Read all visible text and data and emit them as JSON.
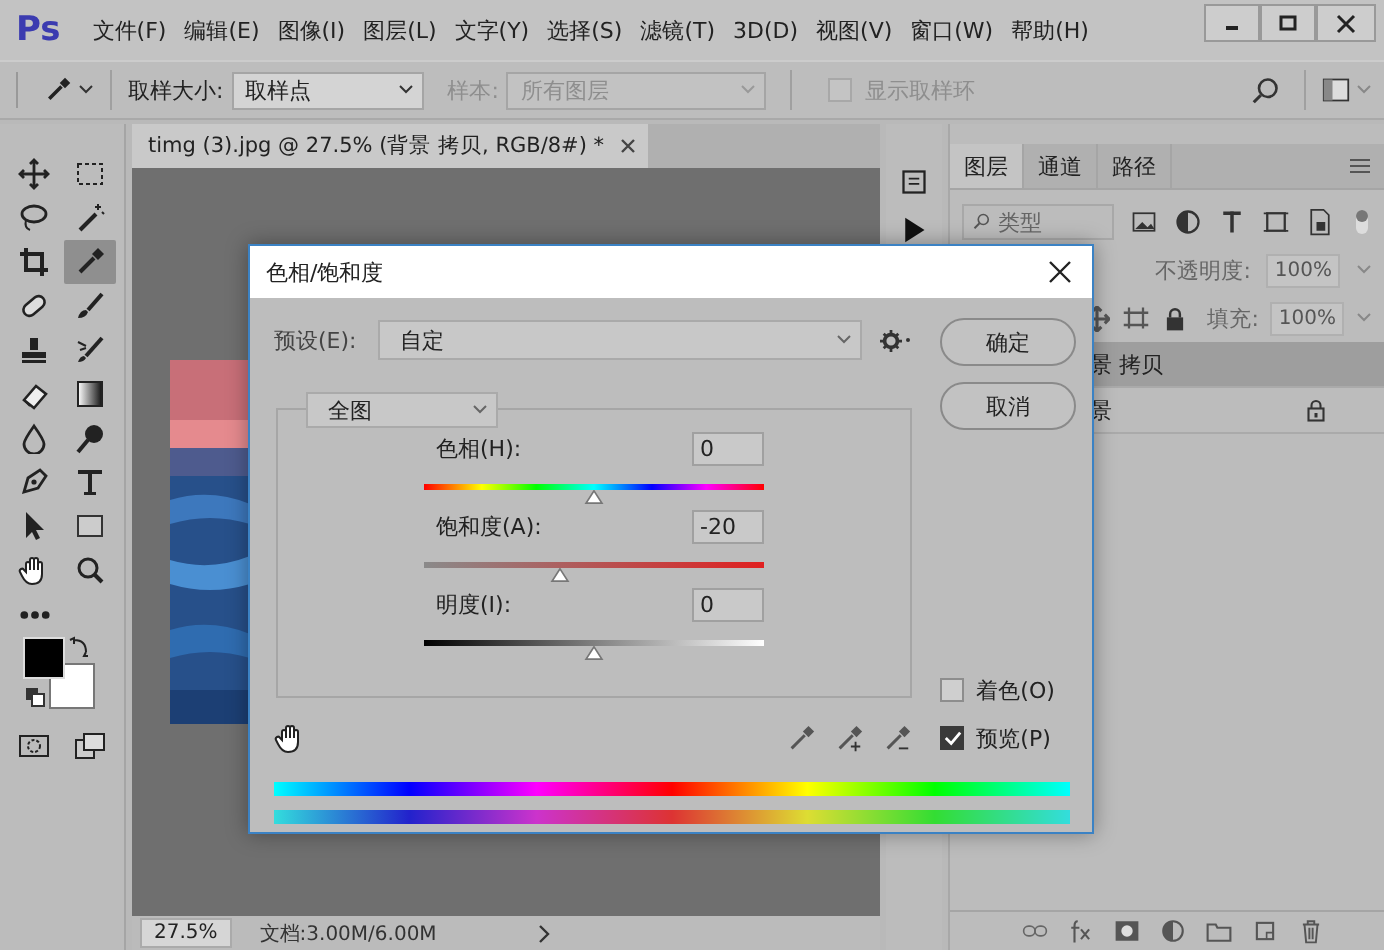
{
  "app": {
    "logo": "Ps"
  },
  "menu": [
    "文件(F)",
    "编辑(E)",
    "图像(I)",
    "图层(L)",
    "文字(Y)",
    "选择(S)",
    "滤镜(T)",
    "3D(D)",
    "视图(V)",
    "窗口(W)",
    "帮助(H)"
  ],
  "options_bar": {
    "sample_size_label": "取样大小:",
    "sample_size": "取样点",
    "sample_label": "样本:",
    "sample": "所有图层",
    "sample_disabled": true,
    "show_ring": {
      "label": "显示取样环",
      "checked": false,
      "disabled": true
    }
  },
  "tools": [
    {
      "kind": "move",
      "selected": false
    },
    {
      "kind": "marquee",
      "selected": false
    },
    {
      "kind": "lasso",
      "selected": false
    },
    {
      "kind": "magic-wand",
      "selected": false
    },
    {
      "kind": "crop",
      "selected": false
    },
    {
      "kind": "eyedropper",
      "selected": true
    },
    {
      "kind": "healing",
      "selected": false
    },
    {
      "kind": "brush",
      "selected": false
    },
    {
      "kind": "stamp",
      "selected": false
    },
    {
      "kind": "history-brush",
      "selected": false
    },
    {
      "kind": "eraser",
      "selected": false
    },
    {
      "kind": "gradient",
      "selected": false
    },
    {
      "kind": "blur",
      "selected": false
    },
    {
      "kind": "dodge",
      "selected": false
    },
    {
      "kind": "pen",
      "selected": false
    },
    {
      "kind": "type",
      "selected": false
    },
    {
      "kind": "path-select",
      "selected": false
    },
    {
      "kind": "rectangle",
      "selected": false
    },
    {
      "kind": "hand",
      "selected": false
    },
    {
      "kind": "zoom",
      "selected": false
    },
    {
      "kind": "more",
      "selected": false
    }
  ],
  "bottom_tools": [
    {
      "kind": "quick-mask"
    },
    {
      "kind": "screen-mode"
    }
  ],
  "document": {
    "tab_title": "timg (3).jpg @ 27.5% (背景 拷贝, RGB/8#) *",
    "zoom": "27.5%",
    "doc_info": "文档:3.00M/6.00M"
  },
  "layers_panel": {
    "tabs": [
      {
        "label": "图层",
        "selected": true
      },
      {
        "label": "通道",
        "selected": false
      },
      {
        "label": "路径",
        "selected": false
      }
    ],
    "filter": "类型",
    "opacity_label": "不透明度:",
    "opacity": "100%",
    "fill_label": "填充:",
    "fill": "100%",
    "layers": [
      {
        "name": "景 拷贝",
        "selected": true,
        "locked": false
      },
      {
        "name": "景",
        "selected": false,
        "locked": true
      }
    ]
  },
  "dialog": {
    "title": "色相/饱和度",
    "preset_label": "预设(E):",
    "preset": "自定",
    "channel": "全图",
    "buttons": [
      "确定",
      "取消"
    ],
    "sliders": [
      {
        "kind": "hue",
        "label": "色相(H):",
        "value": "0",
        "level": 0.5
      },
      {
        "kind": "saturation",
        "label": "饱和度(A):",
        "value": "-20",
        "level": 0.4
      },
      {
        "kind": "lightness",
        "label": "明度(I):",
        "value": "0",
        "level": 0.5
      }
    ],
    "checkboxes": [
      {
        "label": "着色(O)",
        "checked": false
      },
      {
        "label": "预览(P)",
        "checked": true
      }
    ]
  }
}
